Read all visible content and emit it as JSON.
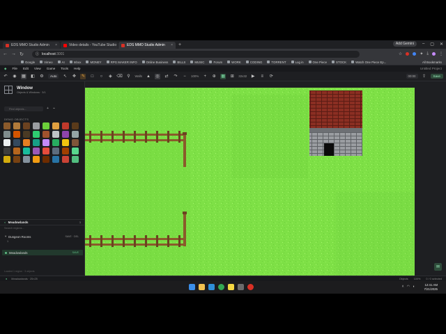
{
  "browser": {
    "tabs": [
      {
        "title": "EDS MMO Studio Admin",
        "active": false,
        "favicon_color": "#d93025"
      },
      {
        "title": "Video details - YouTube Studio",
        "active": false,
        "favicon_color": "#ff0000"
      },
      {
        "title": "EDS MMO Studio Admin",
        "active": true,
        "favicon_color": "#d93025"
      }
    ],
    "new_tab": "+",
    "incognito_label": "Add Gemini",
    "address": {
      "host": "localhost",
      "port": ":3001"
    },
    "bookmarks": [
      "Google",
      "Vimeo",
      "AI",
      "Inbox",
      "MONEY",
      "RPG MAKER INFO",
      "Online Business",
      "BILLS",
      "MUSIC",
      "Forum",
      "WORK",
      "CODING",
      "TORRENT",
      "Log in",
      "One Piece",
      "STOCK",
      "Watch One Piece Ep..."
    ],
    "all_bookmarks": "All Bookmarks"
  },
  "menubar": {
    "items": [
      "File",
      "Edit",
      "View",
      "Game",
      "Tools",
      "Help"
    ],
    "project": "Untitled Project"
  },
  "toolbar": {
    "mode": "Auto",
    "layer_label": "Walls",
    "zoom": "100%",
    "tile_size": "32x32",
    "badge": "00:00",
    "save_label": "Save"
  },
  "panel": {
    "title": "Window",
    "subtitle": "Objects & Windows · 3/1",
    "search_placeholder": "Find objects...",
    "section_objects": "DEMO OBJECTS",
    "regions_title": "Meadowlands",
    "regions_count": "3",
    "region_search": "Search regions...",
    "regions": [
      {
        "name": "Dungeon Rooms",
        "tag": "",
        "selected": false
      },
      {
        "name": "Meadowlands",
        "tag": "SAVE",
        "selected": true
      }
    ],
    "region_sub": "1",
    "footer": "Loaded 1 region · 3 objects"
  },
  "status": {
    "left": "Meadowlands · 25×25",
    "green": "●",
    "right": [
      "Objects",
      "100%",
      "0 / 0 selected"
    ]
  },
  "taskbar": {
    "time": "12:41 AM",
    "date": "7/21/2025"
  },
  "colors": {
    "grass": "#7ee046",
    "fence": "#8a5a2b",
    "roof": "#8b2e22",
    "stone": "#8f9296",
    "accent": "#5fbf86"
  }
}
